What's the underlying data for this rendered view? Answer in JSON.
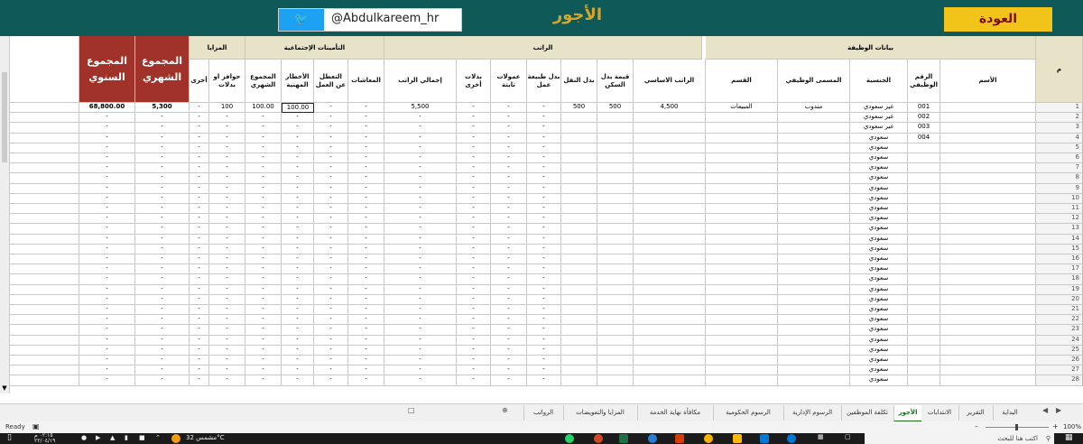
{
  "banner": {
    "title": "الأجور",
    "twitter_handle": "@Abdulkareem_hr",
    "back_label": "العودة"
  },
  "groups": {
    "employee": "بيانات الوظيفة",
    "salary": "الراتب",
    "insurance": "التأمينات الإجتماعية",
    "benefits": "المزايا",
    "m_label": "م"
  },
  "headers": {
    "name": "الأسم",
    "emp_no": "الرقم الوظيفي",
    "nationality": "الجنسية",
    "job_title": "المسمى الوظيفي",
    "department": "القسم",
    "basic": "الراتب الاساسي",
    "housing": "قيمة بدل السكن",
    "transport": "بدل النقل",
    "work_nature": "بدل طبيعة عمل",
    "commissions": "عمولات ثابتة",
    "other_allow": "بدلات أخرى",
    "total_salary": "إجمالي الراتب",
    "pensions": "المعاشات",
    "unemployment": "التعطل عن العمل",
    "hazards": "الأخطار المهنية",
    "monthly_total": "المجموع الشهري",
    "incentives": "حوافز او بدلات",
    "other": "أخرى",
    "monthly_sum": "المجموع الشهري",
    "annual_sum": "المجموع السنوي"
  },
  "row_numbers": [
    "1",
    "2",
    "3",
    "4",
    "5",
    "6",
    "7",
    "8",
    "9",
    "10",
    "11",
    "12",
    "13",
    "14",
    "15",
    "16",
    "17",
    "18",
    "19",
    "20",
    "21",
    "22",
    "23",
    "24",
    "25",
    "26",
    "27",
    "28"
  ],
  "rows": [
    {
      "emp_no": "001",
      "nationality": "غير سعودي",
      "job_title": "مندوب",
      "department": "المبيعات",
      "basic": "4,500",
      "housing": "500",
      "transport": "500",
      "work_nature": "-",
      "commissions": "-",
      "other_allow": "-",
      "total_salary": "5,500",
      "pensions": "-",
      "unemployment": "-",
      "hazards": "100.00",
      "monthly_total": "100.00",
      "incentives": "100",
      "other": "-",
      "monthly_sum": "5,300",
      "annual_sum": "68,800.00"
    },
    {
      "emp_no": "002",
      "nationality": "غير سعودي",
      "job_title": "",
      "department": "",
      "basic": "",
      "housing": "",
      "transport": "",
      "work_nature": "-",
      "commissions": "-",
      "other_allow": "-",
      "total_salary": "-",
      "pensions": "-",
      "unemployment": "-",
      "hazards": "-",
      "monthly_total": "-",
      "incentives": "-",
      "other": "-",
      "monthly_sum": "-",
      "annual_sum": "-"
    },
    {
      "emp_no": "003",
      "nationality": "غير سعودي",
      "job_title": "",
      "department": "",
      "basic": "",
      "housing": "",
      "transport": "",
      "work_nature": "-",
      "commissions": "-",
      "other_allow": "-",
      "total_salary": "-",
      "pensions": "-",
      "unemployment": "-",
      "hazards": "-",
      "monthly_total": "-",
      "incentives": "-",
      "other": "-",
      "monthly_sum": "-",
      "annual_sum": "-"
    },
    {
      "emp_no": "004",
      "nationality": "سعودي",
      "job_title": "",
      "department": "",
      "basic": "",
      "housing": "",
      "transport": "",
      "work_nature": "-",
      "commissions": "-",
      "other_allow": "-",
      "total_salary": "-",
      "pensions": "-",
      "unemployment": "-",
      "hazards": "-",
      "monthly_total": "-",
      "incentives": "-",
      "other": "-",
      "monthly_sum": "-",
      "annual_sum": "-"
    }
  ],
  "filler": {
    "nationality": "سعودي",
    "dash": "-"
  },
  "tabs": [
    "البداية",
    "التقرير",
    "الانتدابات",
    "الأجور",
    "تكلفة الموظفين",
    "الرسوم الإدارية",
    "الرسوم الحكومية",
    "مكافأة نهاية الخدمة",
    "المزايا والتعويضات",
    "الرواتب"
  ],
  "active_tab": "الأجور",
  "status": {
    "ready": "Ready",
    "zoom": "100%"
  },
  "taskbar": {
    "search": "اكتب هنا للبحث",
    "weather": "مشمس 32°C",
    "time": "٠٢:١٥ م",
    "date": "٢٢/٠٤/١٩"
  }
}
